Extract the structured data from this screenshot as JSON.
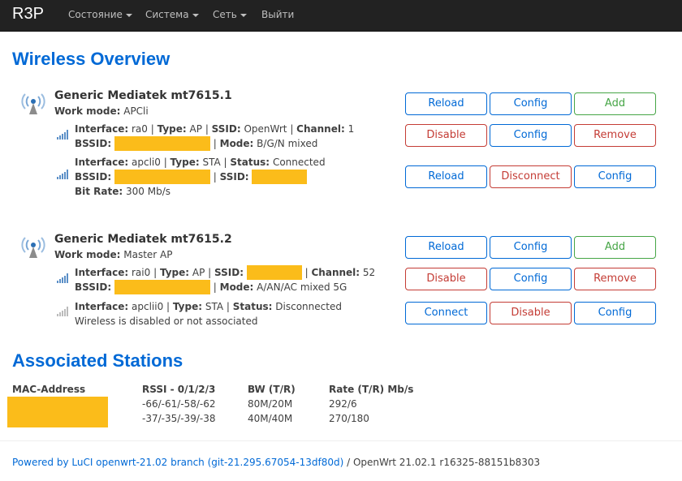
{
  "app": {
    "brand": "R3P",
    "menu": [
      {
        "label": "Состояние",
        "dropdown": true
      },
      {
        "label": "Система",
        "dropdown": true
      },
      {
        "label": "Сеть",
        "dropdown": true
      },
      {
        "label": "Выйти",
        "dropdown": false
      }
    ]
  },
  "page": {
    "title": "Wireless Overview",
    "stations_title": "Associated Stations"
  },
  "devices": [
    {
      "title": "Generic Mediatek mt7615.1",
      "mode_label": "Work mode:",
      "mode": "APCli",
      "buttons": [
        "Reload",
        "Config",
        "Add"
      ],
      "networks": [
        {
          "iface_label": "Interface:",
          "iface": "ra0",
          "type_label": "Type:",
          "type": "AP",
          "ssid_label": "SSID:",
          "ssid": "OpenWrt",
          "channel_label": "Channel:",
          "channel": "1",
          "bssid_label": "BSSID:",
          "mode2_label": "Mode:",
          "mode2": "B/G/N mixed",
          "buttons": [
            "Disable",
            "Config",
            "Remove"
          ]
        },
        {
          "iface_label": "Interface:",
          "iface": "apcli0",
          "type_label": "Type:",
          "type": "STA",
          "status_label": "Status:",
          "status": "Connected",
          "bssid_label": "BSSID:",
          "ssid_label": "SSID:",
          "bitrate_label": "Bit Rate:",
          "bitrate": "300 Mb/s",
          "buttons": [
            "Reload",
            "Disconnect",
            "Config"
          ]
        }
      ]
    },
    {
      "title": "Generic Mediatek mt7615.2",
      "mode_label": "Work mode:",
      "mode": "Master AP",
      "buttons": [
        "Reload",
        "Config",
        "Add"
      ],
      "networks": [
        {
          "iface_label": "Interface:",
          "iface": "rai0",
          "type_label": "Type:",
          "type": "AP",
          "ssid_label": "SSID:",
          "channel_label": "Channel:",
          "channel": "52",
          "bssid_label": "BSSID:",
          "mode2_label": "Mode:",
          "mode2": "A/AN/AC mixed 5G",
          "buttons": [
            "Disable",
            "Config",
            "Remove"
          ]
        },
        {
          "iface_label": "Interface:",
          "iface": "apclii0",
          "type_label": "Type:",
          "type": "STA",
          "status_label": "Status:",
          "status": "Disconnected",
          "note": "Wireless is disabled or not associated",
          "buttons": [
            "Connect",
            "Disable",
            "Config"
          ]
        }
      ]
    }
  ],
  "stations": {
    "headers": [
      "MAC-Address",
      "RSSI - 0/1/2/3",
      "BW (T/R)",
      "Rate (T/R) Mb/s"
    ],
    "rows": [
      {
        "rssi": "-66/-61/-58/-62",
        "bw": "80M/20M",
        "rate": "292/6"
      },
      {
        "rssi": "-37/-35/-39/-38",
        "bw": "40M/40M",
        "rate": "270/180"
      }
    ]
  },
  "footer": {
    "link": "Powered by LuCI openwrt-21.02 branch (git-21.295.67054-13df80d)",
    "version": " / OpenWrt 21.02.1 r16325-88151b8303"
  },
  "colors": {
    "accent": "#0069d6",
    "danger": "#c43c35",
    "success": "#46a546",
    "redaction": "#fbbc1a",
    "navbar": "#222222"
  }
}
